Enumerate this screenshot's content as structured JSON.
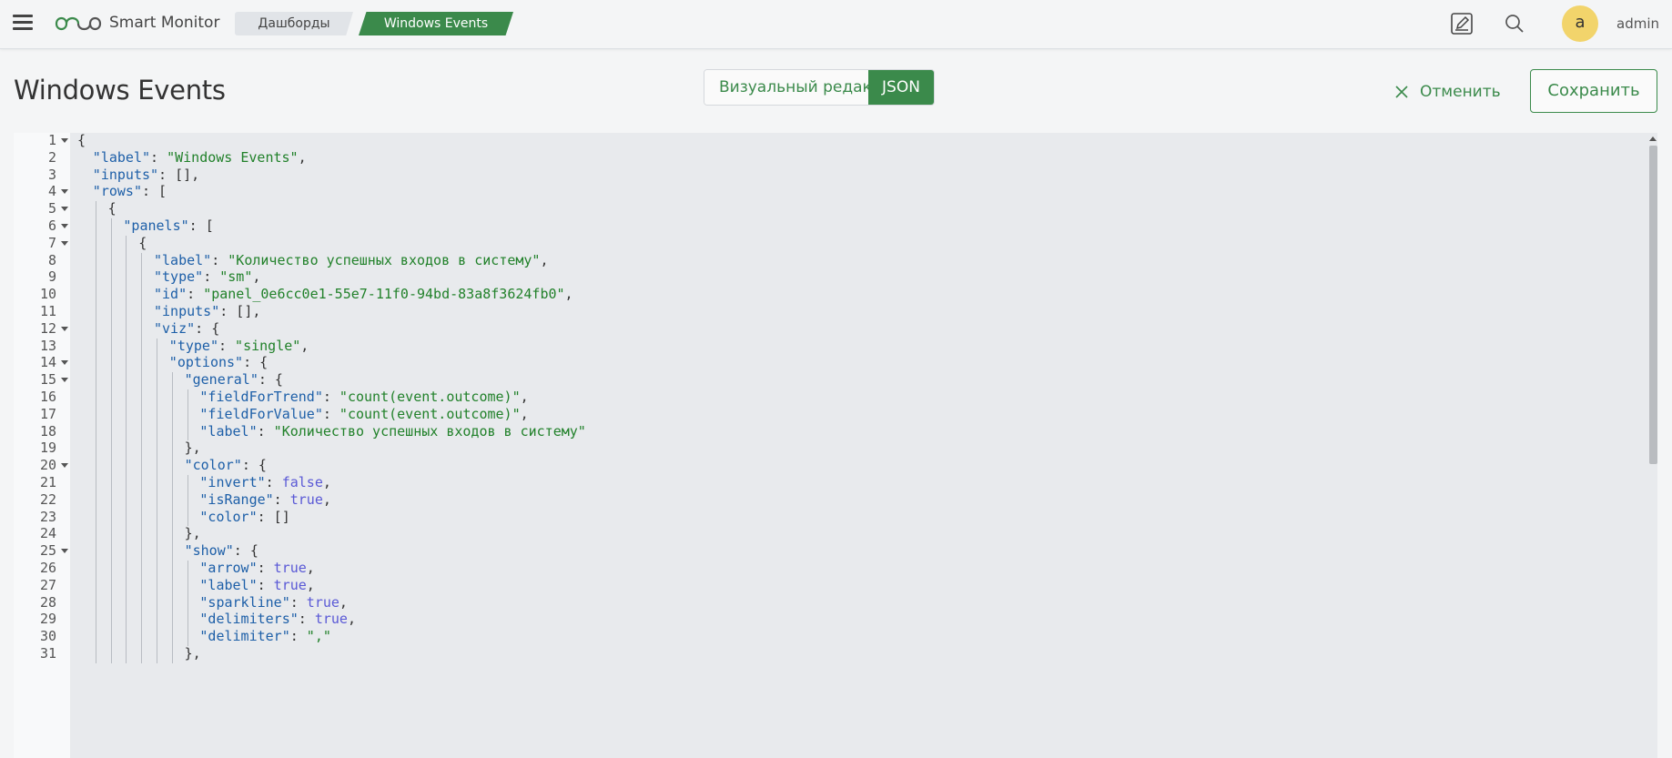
{
  "app": {
    "brand": "Smart Monitor",
    "breadcrumbs": [
      "Дашборды",
      "Windows Events"
    ],
    "user": {
      "initial": "a",
      "name": "admin"
    },
    "accent_color": "#3b8a4b",
    "avatar_color": "#f2d46b"
  },
  "page": {
    "title": "Windows Events",
    "mode_visual": "Визуальный редактор",
    "mode_json": "JSON",
    "active_mode": "JSON",
    "cancel": "Отменить",
    "save": "Сохранить"
  },
  "editor": {
    "lines": [
      {
        "n": "1",
        "indent": 0,
        "fold": true,
        "tokens": [
          [
            "p",
            "{"
          ]
        ]
      },
      {
        "n": "2",
        "indent": 1,
        "fold": false,
        "tokens": [
          [
            "k",
            "\"label\""
          ],
          [
            "p",
            ": "
          ],
          [
            "s",
            "\"Windows Events\""
          ],
          [
            "p",
            ","
          ]
        ]
      },
      {
        "n": "3",
        "indent": 1,
        "fold": false,
        "tokens": [
          [
            "k",
            "\"inputs\""
          ],
          [
            "p",
            ": [],"
          ]
        ]
      },
      {
        "n": "4",
        "indent": 1,
        "fold": true,
        "tokens": [
          [
            "k",
            "\"rows\""
          ],
          [
            "p",
            ": ["
          ]
        ]
      },
      {
        "n": "5",
        "indent": 2,
        "fold": true,
        "tokens": [
          [
            "p",
            "{"
          ]
        ]
      },
      {
        "n": "6",
        "indent": 3,
        "fold": true,
        "tokens": [
          [
            "k",
            "\"panels\""
          ],
          [
            "p",
            ": ["
          ]
        ]
      },
      {
        "n": "7",
        "indent": 4,
        "fold": true,
        "tokens": [
          [
            "p",
            "{"
          ]
        ]
      },
      {
        "n": "8",
        "indent": 5,
        "fold": false,
        "tokens": [
          [
            "k",
            "\"label\""
          ],
          [
            "p",
            ": "
          ],
          [
            "s",
            "\"Количество успешных входов в систему\""
          ],
          [
            "p",
            ","
          ]
        ]
      },
      {
        "n": "9",
        "indent": 5,
        "fold": false,
        "tokens": [
          [
            "k",
            "\"type\""
          ],
          [
            "p",
            ": "
          ],
          [
            "s",
            "\"sm\""
          ],
          [
            "p",
            ","
          ]
        ]
      },
      {
        "n": "10",
        "indent": 5,
        "fold": false,
        "tokens": [
          [
            "k",
            "\"id\""
          ],
          [
            "p",
            ": "
          ],
          [
            "s",
            "\"panel_0e6cc0e1-55e7-11f0-94bd-83a8f3624fb0\""
          ],
          [
            "p",
            ","
          ]
        ]
      },
      {
        "n": "11",
        "indent": 5,
        "fold": false,
        "tokens": [
          [
            "k",
            "\"inputs\""
          ],
          [
            "p",
            ": [],"
          ]
        ]
      },
      {
        "n": "12",
        "indent": 5,
        "fold": true,
        "tokens": [
          [
            "k",
            "\"viz\""
          ],
          [
            "p",
            ": {"
          ]
        ]
      },
      {
        "n": "13",
        "indent": 6,
        "fold": false,
        "tokens": [
          [
            "k",
            "\"type\""
          ],
          [
            "p",
            ": "
          ],
          [
            "s",
            "\"single\""
          ],
          [
            "p",
            ","
          ]
        ]
      },
      {
        "n": "14",
        "indent": 6,
        "fold": true,
        "tokens": [
          [
            "k",
            "\"options\""
          ],
          [
            "p",
            ": {"
          ]
        ]
      },
      {
        "n": "15",
        "indent": 7,
        "fold": true,
        "tokens": [
          [
            "k",
            "\"general\""
          ],
          [
            "p",
            ": {"
          ]
        ]
      },
      {
        "n": "16",
        "indent": 8,
        "fold": false,
        "tokens": [
          [
            "k",
            "\"fieldForTrend\""
          ],
          [
            "p",
            ": "
          ],
          [
            "s",
            "\"count(event.outcome)\""
          ],
          [
            "p",
            ","
          ]
        ]
      },
      {
        "n": "17",
        "indent": 8,
        "fold": false,
        "tokens": [
          [
            "k",
            "\"fieldForValue\""
          ],
          [
            "p",
            ": "
          ],
          [
            "s",
            "\"count(event.outcome)\""
          ],
          [
            "p",
            ","
          ]
        ]
      },
      {
        "n": "18",
        "indent": 8,
        "fold": false,
        "tokens": [
          [
            "k",
            "\"label\""
          ],
          [
            "p",
            ": "
          ],
          [
            "s",
            "\"Количество успешных входов в систему\""
          ]
        ]
      },
      {
        "n": "19",
        "indent": 7,
        "fold": false,
        "tokens": [
          [
            "p",
            "},"
          ]
        ]
      },
      {
        "n": "20",
        "indent": 7,
        "fold": true,
        "tokens": [
          [
            "k",
            "\"color\""
          ],
          [
            "p",
            ": {"
          ]
        ]
      },
      {
        "n": "21",
        "indent": 8,
        "fold": false,
        "tokens": [
          [
            "k",
            "\"invert\""
          ],
          [
            "p",
            ": "
          ],
          [
            "b",
            "false"
          ],
          [
            "p",
            ","
          ]
        ]
      },
      {
        "n": "22",
        "indent": 8,
        "fold": false,
        "tokens": [
          [
            "k",
            "\"isRange\""
          ],
          [
            "p",
            ": "
          ],
          [
            "b",
            "true"
          ],
          [
            "p",
            ","
          ]
        ]
      },
      {
        "n": "23",
        "indent": 8,
        "fold": false,
        "tokens": [
          [
            "k",
            "\"color\""
          ],
          [
            "p",
            ": []"
          ]
        ]
      },
      {
        "n": "24",
        "indent": 7,
        "fold": false,
        "tokens": [
          [
            "p",
            "},"
          ]
        ]
      },
      {
        "n": "25",
        "indent": 7,
        "fold": true,
        "tokens": [
          [
            "k",
            "\"show\""
          ],
          [
            "p",
            ": {"
          ]
        ]
      },
      {
        "n": "26",
        "indent": 8,
        "fold": false,
        "tokens": [
          [
            "k",
            "\"arrow\""
          ],
          [
            "p",
            ": "
          ],
          [
            "b",
            "true"
          ],
          [
            "p",
            ","
          ]
        ]
      },
      {
        "n": "27",
        "indent": 8,
        "fold": false,
        "tokens": [
          [
            "k",
            "\"label\""
          ],
          [
            "p",
            ": "
          ],
          [
            "b",
            "true"
          ],
          [
            "p",
            ","
          ]
        ]
      },
      {
        "n": "28",
        "indent": 8,
        "fold": false,
        "tokens": [
          [
            "k",
            "\"sparkline\""
          ],
          [
            "p",
            ": "
          ],
          [
            "b",
            "true"
          ],
          [
            "p",
            ","
          ]
        ]
      },
      {
        "n": "29",
        "indent": 8,
        "fold": false,
        "tokens": [
          [
            "k",
            "\"delimiters\""
          ],
          [
            "p",
            ": "
          ],
          [
            "b",
            "true"
          ],
          [
            "p",
            ","
          ]
        ]
      },
      {
        "n": "30",
        "indent": 8,
        "fold": false,
        "tokens": [
          [
            "k",
            "\"delimiter\""
          ],
          [
            "p",
            ": "
          ],
          [
            "s",
            "\",\""
          ]
        ]
      },
      {
        "n": "31",
        "indent": 7,
        "fold": false,
        "tokens": [
          [
            "p",
            "},"
          ]
        ]
      }
    ]
  }
}
